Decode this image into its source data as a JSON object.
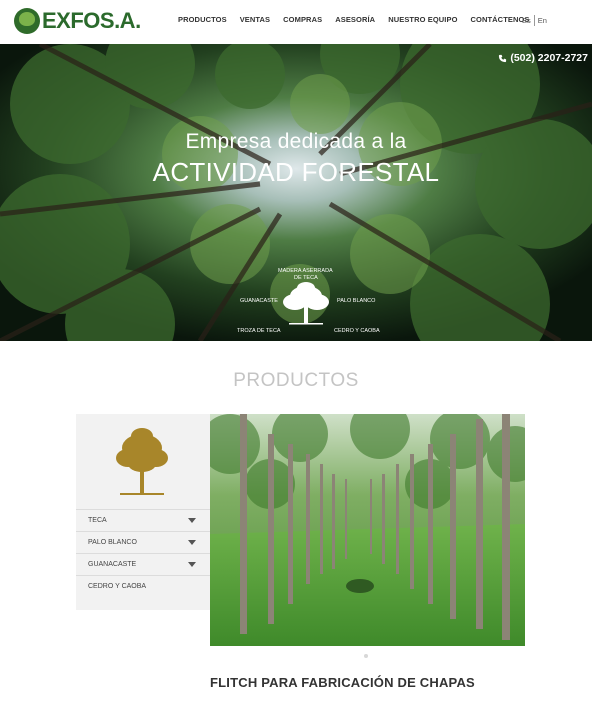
{
  "brand": {
    "name": "EXFOS.A."
  },
  "nav": {
    "items": [
      "PRODUCTOS",
      "VENTAS",
      "COMPRAS",
      "ASESORÍA",
      "NUESTRO EQUIPO",
      "CONTÁCTENOS"
    ]
  },
  "lang": {
    "es": "Es",
    "en": "En"
  },
  "hero": {
    "phone": "(502) 2207-2727",
    "line1": "Empresa dedicada a la",
    "line2": "ACTIVIDAD FORESTAL",
    "emblem_labels": {
      "top": "MADERA ASERRADA",
      "top2": "DE TECA",
      "left": "GUANACASTE",
      "right": "PALO BLANCO",
      "bottom_left": "TROZA DE TECA",
      "bottom_right": "CEDRO Y CAOBA"
    }
  },
  "products": {
    "title": "PRODUCTOS",
    "sidebar": [
      {
        "label": "TECA",
        "has_caret": true
      },
      {
        "label": "PALO BLANCO",
        "has_caret": true
      },
      {
        "label": "GUANACASTE",
        "has_caret": true
      },
      {
        "label": "CEDRO Y CAOBA",
        "has_caret": false
      }
    ],
    "product_title": "FLITCH PARA FABRICACIÓN DE CHAPAS"
  },
  "colors": {
    "brand_green": "#2b6a2c",
    "tree_gold": "#a8862a"
  }
}
